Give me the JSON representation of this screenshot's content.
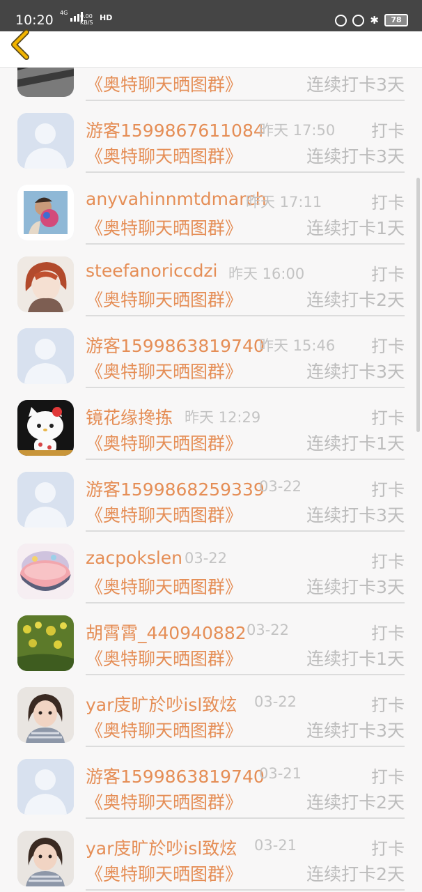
{
  "status_bar": {
    "time": "10:20",
    "network_type": "4G",
    "speed_value": "0.00",
    "speed_unit": "KB/S",
    "hd": "HD",
    "battery": "78"
  },
  "header": {
    "back_icon": "chevron-left-icon",
    "accent_color": "#f2b400"
  },
  "colors": {
    "orange": "#e58e56",
    "gray": "#bcbcbc"
  },
  "rows": [
    {
      "name": "",
      "time": "",
      "action": "",
      "group": "《奥特聊天晒图群》",
      "streak": "连续打卡3天",
      "avatar": "bw-photo"
    },
    {
      "name": "游客1599867611084",
      "time": "昨天 17:50",
      "action": "打卡",
      "group": "《奥特聊天晒图群》",
      "streak": "连续打卡3天",
      "avatar": "default-silhouette"
    },
    {
      "name": "anyvahinnmtdmarch",
      "time": "昨天 17:11",
      "action": "打卡",
      "group": "《奥特聊天晒图群》",
      "streak": "连续打卡1天",
      "avatar": "man-with-flowers"
    },
    {
      "name": "steefanoriccdzi",
      "time": "昨天 16:00",
      "action": "打卡",
      "group": "《奥特聊天晒图群》",
      "streak": "连续打卡2天",
      "avatar": "anime-red-hair"
    },
    {
      "name": "游客1599863819740",
      "time": "昨天 15:46",
      "action": "打卡",
      "group": "《奥特聊天晒图群》",
      "streak": "连续打卡3天",
      "avatar": "default-silhouette"
    },
    {
      "name": "镜花缘搀拣",
      "time": "昨天 12:29",
      "action": "打卡",
      "group": "《奥特聊天晒图群》",
      "streak": "连续打卡1天",
      "avatar": "hello-kitty"
    },
    {
      "name": "游客1599868259339",
      "time": "03-22",
      "action": "打卡",
      "group": "《奥特聊天晒图群》",
      "streak": "连续打卡3天",
      "avatar": "default-silhouette"
    },
    {
      "name": "zacpokslen",
      "time": "03-22",
      "action": "打卡",
      "group": "《奥特聊天晒图群》",
      "streak": "连续打卡3天",
      "avatar": "cake-bowl"
    },
    {
      "name": "胡霄霄_440940882",
      "time": "03-22",
      "action": "打卡",
      "group": "《奥特聊天晒图群》",
      "streak": "连续打卡1天",
      "avatar": "rapeseed-field"
    },
    {
      "name": "yar庋旷於吵isl致炫",
      "time": "03-22",
      "action": "打卡",
      "group": "《奥特聊天晒图群》",
      "streak": "连续打卡3天",
      "avatar": "little-girl"
    },
    {
      "name": "游客1599863819740",
      "time": "03-21",
      "action": "打卡",
      "group": "《奥特聊天晒图群》",
      "streak": "连续打卡2天",
      "avatar": "default-silhouette"
    },
    {
      "name": "yar庋旷於吵isl致炫",
      "time": "03-21",
      "action": "打卡",
      "group": "《奥特聊天晒图群》",
      "streak": "连续打卡2天",
      "avatar": "little-girl"
    }
  ]
}
